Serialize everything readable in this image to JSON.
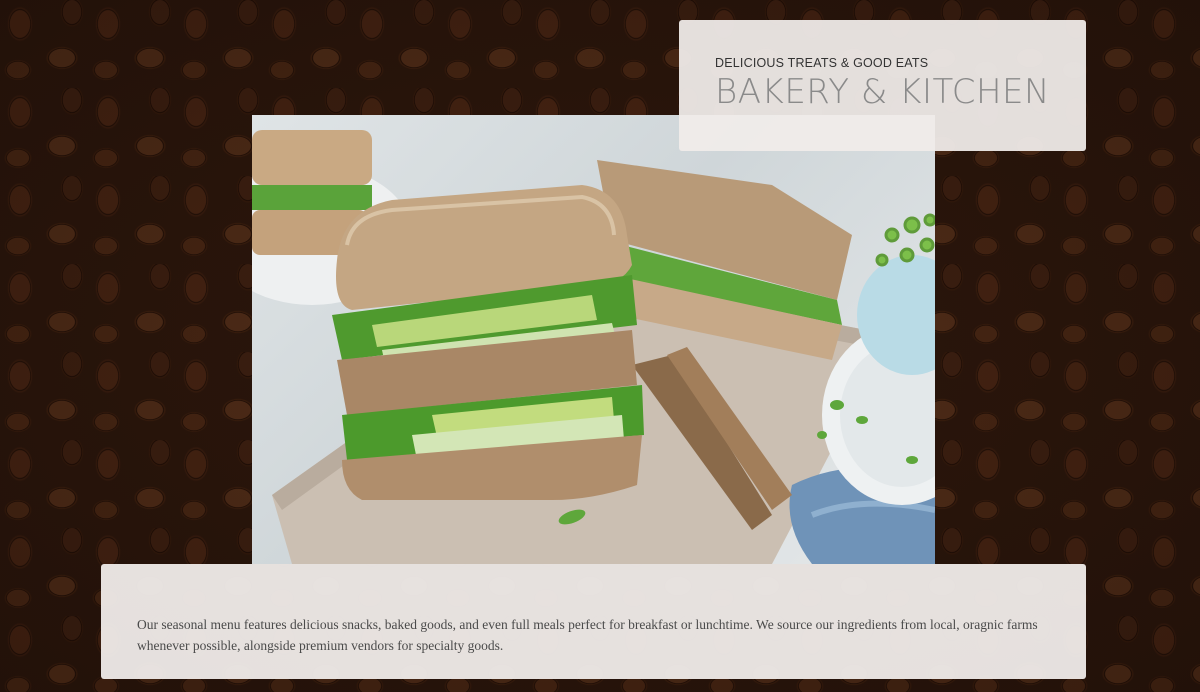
{
  "hero": {
    "eyebrow": "DELICIOUS TREATS & GOOD EATS",
    "title": "BAKERY & KITCHEN"
  },
  "photo": {
    "subject": "sandwich-photo"
  },
  "description": {
    "text": "Our seasonal menu features delicious snacks, baked goods, and even full meals perfect for breakfast or lunchtime. We source our ingredients from local, oragnic farms whenever possible, alongside premium vendors for specialty goods."
  },
  "colors": {
    "background": "#2a160c",
    "card": "#f0ecea",
    "title": "#8a8a8a",
    "eyebrow": "#333333",
    "body_text": "#4a4a4a"
  }
}
